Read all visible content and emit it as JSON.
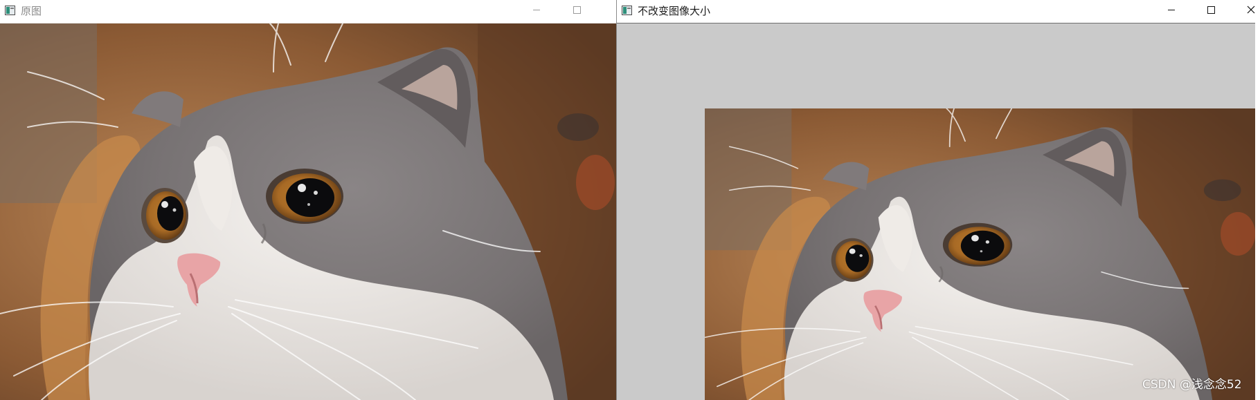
{
  "windows": [
    {
      "title": "原图",
      "controls": [
        "minimize-icon",
        "maximize-icon"
      ]
    },
    {
      "title": "不改变图像大小",
      "controls": [
        "minimize-icon",
        "maximize-icon",
        "close-icon"
      ],
      "canvas_background": "#cacaca"
    }
  ],
  "photo_subject": "grey-and-white-cat-closeup",
  "watermark": "CSDN @浅念念52",
  "colors": {
    "titlebar": "#ffffff",
    "viewport_gray": "#cacaca",
    "icon_teal": "#2d8f7a"
  }
}
